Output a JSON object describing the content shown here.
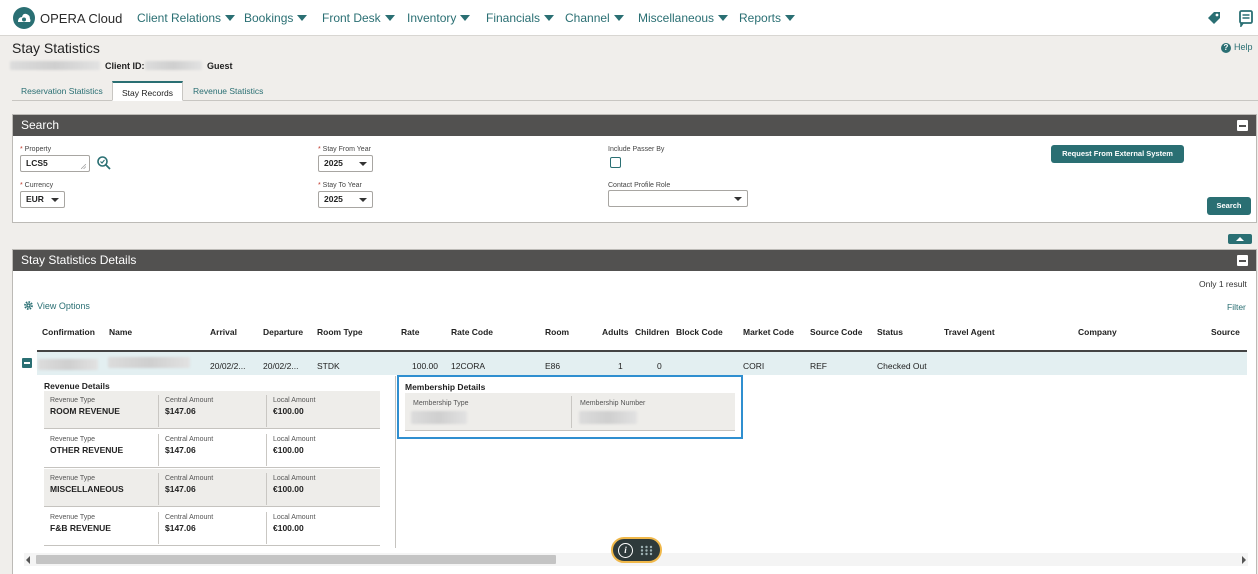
{
  "app": {
    "brand": "OPERA Cloud"
  },
  "nav": [
    {
      "label": "Client Relations"
    },
    {
      "label": "Bookings"
    },
    {
      "label": "Front Desk"
    },
    {
      "label": "Inventory"
    },
    {
      "label": "Financials"
    },
    {
      "label": "Channel"
    },
    {
      "label": "Miscellaneous"
    },
    {
      "label": "Reports"
    }
  ],
  "page": {
    "title": "Stay Statistics",
    "help": "Help",
    "client_id_label": "Client ID:",
    "guest_label": "Guest"
  },
  "tabs": [
    {
      "label": "Reservation Statistics",
      "active": false
    },
    {
      "label": "Stay Records",
      "active": true
    },
    {
      "label": "Revenue Statistics",
      "active": false
    }
  ],
  "search": {
    "title": "Search",
    "property_label": "Property",
    "property_value": "LCS5",
    "currency_label": "Currency",
    "currency_value": "EUR",
    "stay_from_label": "Stay From Year",
    "stay_from_value": "2025",
    "stay_to_label": "Stay To Year",
    "stay_to_value": "2025",
    "passer_label": "Include Passer By",
    "contact_role_label": "Contact Profile Role",
    "contact_role_value": "",
    "external_button": "Request From External System",
    "search_button": "Search"
  },
  "details": {
    "title": "Stay Statistics Details",
    "result_count": "Only 1 result",
    "view_options": "View Options",
    "filter": "Filter",
    "columns": [
      "Confirmation",
      "Name",
      "Arrival",
      "Departure",
      "Room Type",
      "Rate",
      "Rate Code",
      "Room",
      "Adults",
      "Children",
      "Block Code",
      "Market Code",
      "Source Code",
      "Status",
      "Travel Agent",
      "Company",
      "Source"
    ],
    "row": {
      "arrival": "20/02/2...",
      "departure": "20/02/2...",
      "room_type": "STDK",
      "rate": "100.00",
      "rate_code": "12CORA",
      "room": "E86",
      "adults": "1",
      "children": "0",
      "market_code": "CORI",
      "source_code": "REF",
      "status": "Checked Out"
    },
    "revenue_title": "Revenue Details",
    "revenue_labels": {
      "type": "Revenue Type",
      "central": "Central Amount",
      "local": "Local Amount"
    },
    "revenue_rows": [
      {
        "type": "ROOM REVENUE",
        "central": "$147.06",
        "local": "€100.00"
      },
      {
        "type": "OTHER REVENUE",
        "central": "$147.06",
        "local": "€100.00"
      },
      {
        "type": "MISCELLANEOUS",
        "central": "$147.06",
        "local": "€100.00"
      },
      {
        "type": "F&B REVENUE",
        "central": "$147.06",
        "local": "€100.00"
      }
    ],
    "membership_title": "Membership Details",
    "membership_type_label": "Membership Type",
    "membership_number_label": "Membership Number"
  },
  "colors": {
    "accent": "#2a6f73",
    "header_bar": "#525150",
    "highlight": "#2f8fd0"
  }
}
